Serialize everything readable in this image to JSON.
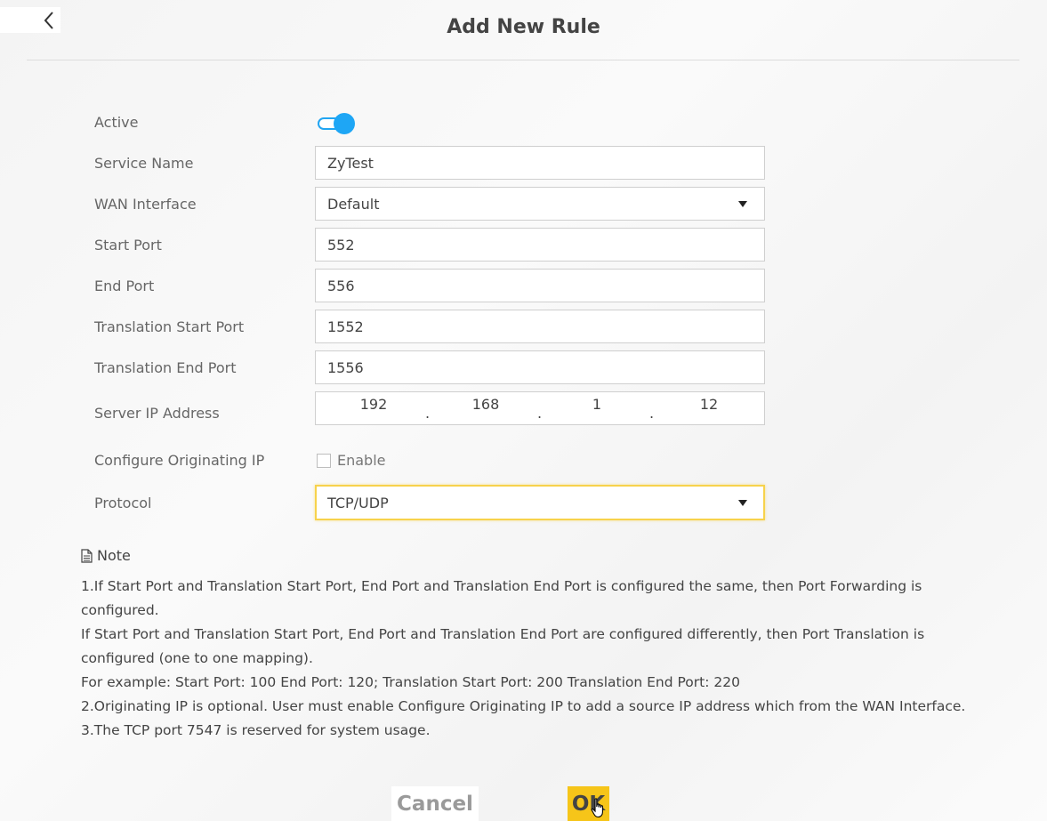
{
  "header": {
    "title": "Add New Rule"
  },
  "form": {
    "active_label": "Active",
    "active_on": true,
    "service_name_label": "Service Name",
    "service_name_value": "ZyTest",
    "wan_interface_label": "WAN Interface",
    "wan_interface_value": "Default",
    "start_port_label": "Start Port",
    "start_port_value": "552",
    "end_port_label": "End Port",
    "end_port_value": "556",
    "translation_start_port_label": "Translation Start Port",
    "translation_start_port_value": "1552",
    "translation_end_port_label": "Translation End Port",
    "translation_end_port_value": "1556",
    "server_ip_label": "Server IP Address",
    "server_ip": [
      "192",
      "168",
      "1",
      "12"
    ],
    "ip_separator": ".",
    "originating_ip_label": "Configure Originating IP",
    "originating_ip_checkbox_label": "Enable",
    "originating_ip_checked": false,
    "protocol_label": "Protocol",
    "protocol_value": "TCP/UDP"
  },
  "note": {
    "title": "Note",
    "lines": [
      "1.If Start Port and Translation Start Port, End Port and Translation End Port is configured the same, then Port Forwarding is configured.",
      "If Start Port and Translation Start Port, End Port and Translation End Port are configured differently, then Port Translation is configured (one to one mapping).",
      "For example: Start Port: 100 End Port: 120; Translation Start Port: 200 Translation End Port: 220",
      "2.Originating IP is optional. User must enable Configure Originating IP to add a source IP address which from the WAN Interface.",
      "3.The TCP port 7547 is reserved for system usage."
    ]
  },
  "actions": {
    "cancel_label": "Cancel",
    "ok_label": "OK"
  },
  "colors": {
    "accent_blue": "#1ea6f5",
    "ok_yellow": "#f6c519",
    "focus_yellow": "#f7d24c"
  },
  "icons": {
    "back": "chevron-left-icon",
    "note": "document-icon",
    "dropdown": "caret-down-icon",
    "cursor": "hand-pointer-icon"
  }
}
